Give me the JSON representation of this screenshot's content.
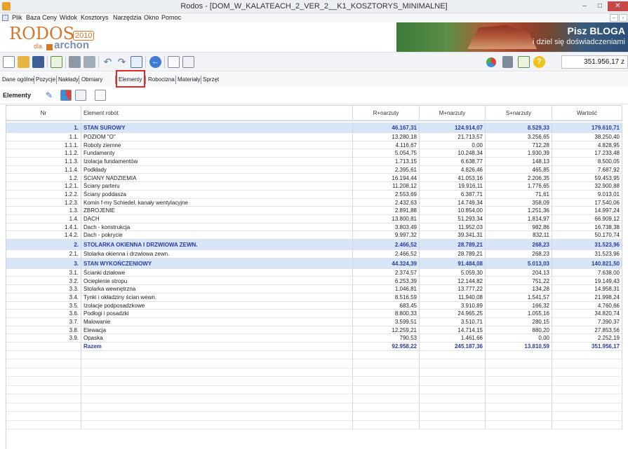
{
  "window": {
    "title": "Rodos - [DOM_W_KALATEACH_2_VER_2__K1_KOSZTORYS_MINIMALNE]",
    "controls": {
      "minimize": "–",
      "maximize": "□",
      "close": "✕"
    }
  },
  "menu": {
    "items": [
      "Plik",
      "Baza",
      "Ceny",
      "Widok",
      "Kosztorys",
      "Narzędzia",
      "Okno",
      "Pomoc"
    ],
    "mdi_controls": {
      "minimize": "–",
      "restore": "▫"
    }
  },
  "banner": {
    "logo_text": "RODOS",
    "logo_year": "2010",
    "logo_dla": "dla",
    "logo_archon": "archon",
    "promo_line1": "Pisz BLOGA",
    "promo_line2": "i dziel się doświadczeniami"
  },
  "toolbar": {
    "total_value": "351.956,17 z",
    "icons": [
      "new-file-icon",
      "open-folder-icon",
      "save-icon",
      "check-icon",
      "print-icon",
      "print-preview-icon",
      "undo-icon",
      "redo-icon",
      "window-icon",
      "back-icon",
      "preview-icon",
      "list-icon",
      "pie-chart-icon",
      "calculator-icon",
      "validate-icon",
      "help-icon"
    ]
  },
  "tabs": [
    {
      "label": "Dane ogólne"
    },
    {
      "label": "Pozycje"
    },
    {
      "label": "Nakłady"
    },
    {
      "label": "Obmiary"
    },
    {
      "label": "Elementy",
      "active": true
    },
    {
      "label": "Robocizna"
    },
    {
      "label": "Materiały"
    },
    {
      "label": "Sprzęt"
    }
  ],
  "section": {
    "title": "Elementy"
  },
  "table": {
    "columns": [
      "Nr",
      "Element robót",
      "R+narzuty",
      "M+narzuty",
      "S+narzuty",
      "Wartość"
    ],
    "rows": [
      {
        "nr": "1.",
        "name": "STAN SUROWY",
        "r": "46.167,31",
        "m": "124.914,07",
        "s": "8.529,33",
        "w": "179.610,71",
        "type": "group"
      },
      {
        "nr": "1.1.",
        "name": "POZIOM \"O\"",
        "r": "13.280,18",
        "m": "21.713,57",
        "s": "3.256,65",
        "w": "38.250,40"
      },
      {
        "nr": "1.1.1.",
        "name": "Roboty ziemne",
        "r": "4.116,67",
        "m": "0,00",
        "s": "712,28",
        "w": "4.828,95"
      },
      {
        "nr": "1.1.2.",
        "name": "Fundamenty",
        "r": "5.054,75",
        "m": "10.248,34",
        "s": "1.930,39",
        "w": "17.233,48"
      },
      {
        "nr": "1.1.3.",
        "name": "Izolacja fundamentów",
        "r": "1.713,15",
        "m": "6.638,77",
        "s": "148,13",
        "w": "8.500,05"
      },
      {
        "nr": "1.1.4.",
        "name": "Podkłady",
        "r": "2.395,61",
        "m": "4.826,46",
        "s": "465,85",
        "w": "7.687,92"
      },
      {
        "nr": "1.2.",
        "name": "ŚCIANY NADZIEMIA",
        "r": "16.194,44",
        "m": "41.053,16",
        "s": "2.206,35",
        "w": "59.453,95"
      },
      {
        "nr": "1.2.1.",
        "name": "Ściany parteru",
        "r": "11.208,12",
        "m": "19.916,11",
        "s": "1.776,65",
        "w": "32.900,88"
      },
      {
        "nr": "1.2.2.",
        "name": "Ściany poddasza",
        "r": "2.553,69",
        "m": "6.387,71",
        "s": "71,61",
        "w": "9.013,01"
      },
      {
        "nr": "1.2.3.",
        "name": "Komin f-my Schiedel, kanały wentylacyjne",
        "r": "2.432,63",
        "m": "14.749,34",
        "s": "358,09",
        "w": "17.540,06"
      },
      {
        "nr": "1.3.",
        "name": "ZBROJENIE",
        "r": "2.891,88",
        "m": "10.854,00",
        "s": "1.251,36",
        "w": "14.997,24"
      },
      {
        "nr": "1.4.",
        "name": "DACH",
        "r": "13.800,81",
        "m": "51.293,34",
        "s": "1.814,97",
        "w": "66.909,12"
      },
      {
        "nr": "1.4.1.",
        "name": "Dach - konstrukcja",
        "r": "3.803,49",
        "m": "11.952,03",
        "s": "982,86",
        "w": "16.738,38"
      },
      {
        "nr": "1.4.2.",
        "name": "Dach - pokrycie",
        "r": "9.997,32",
        "m": "39.341,31",
        "s": "832,11",
        "w": "50.170,74"
      },
      {
        "nr": "2.",
        "name": "STOLARKA OKIENNA I DRZWIOWA ZEWN.",
        "r": "2.466,52",
        "m": "28.789,21",
        "s": "268,23",
        "w": "31.523,96",
        "type": "group"
      },
      {
        "nr": "2.1.",
        "name": "Stolarka okienna i drzwiowa zewn.",
        "r": "2.466,52",
        "m": "28.789,21",
        "s": "268,23",
        "w": "31.523,96"
      },
      {
        "nr": "3.",
        "name": "STAN WYKOŃCZENIOWY",
        "r": "44.324,39",
        "m": "91.484,08",
        "s": "5.013,03",
        "w": "140.821,50",
        "type": "group"
      },
      {
        "nr": "3.1.",
        "name": "Ścianki działowe",
        "r": "2.374,57",
        "m": "5.059,30",
        "s": "204,13",
        "w": "7.638,00"
      },
      {
        "nr": "3.2.",
        "name": "Ocieplenie stropu",
        "r": "6.253,39",
        "m": "12.144,82",
        "s": "751,22",
        "w": "19.149,43"
      },
      {
        "nr": "3.3.",
        "name": "Stolarka wewnętrzna",
        "r": "1.046,81",
        "m": "13.777,22",
        "s": "134,28",
        "w": "14.958,31"
      },
      {
        "nr": "3.4.",
        "name": "Tynki i okładziny ścian wewn.",
        "r": "8.516,59",
        "m": "11.940,08",
        "s": "1.541,57",
        "w": "21.998,24"
      },
      {
        "nr": "3.5.",
        "name": "Izolacje podposadzkowe",
        "r": "683,45",
        "m": "3.910,89",
        "s": "166,32",
        "w": "4.760,66"
      },
      {
        "nr": "3.6.",
        "name": "Podłogi i posadzki",
        "r": "8.800,33",
        "m": "24.965,25",
        "s": "1.055,16",
        "w": "34.820,74"
      },
      {
        "nr": "3.7.",
        "name": "Malowanie",
        "r": "3.599,51",
        "m": "3.510,71",
        "s": "280,15",
        "w": "7.390,37"
      },
      {
        "nr": "3.8.",
        "name": "Elewacja",
        "r": "12.259,21",
        "m": "14.714,15",
        "s": "880,20",
        "w": "27.853,56"
      },
      {
        "nr": "3.9.",
        "name": "Opaska",
        "r": "790,53",
        "m": "1.461,66",
        "s": "0,00",
        "w": "2.252,19"
      },
      {
        "nr": "",
        "name": "Razem",
        "r": "92.958,22",
        "m": "245.187,36",
        "s": "13.810,59",
        "w": "351.956,17",
        "type": "total"
      }
    ]
  },
  "colors": {
    "group_row_bg": "#d7e6f6",
    "group_text": "#2c3ba5",
    "highlight_border": "#e02a27",
    "brand_orange": "#d4752b"
  }
}
